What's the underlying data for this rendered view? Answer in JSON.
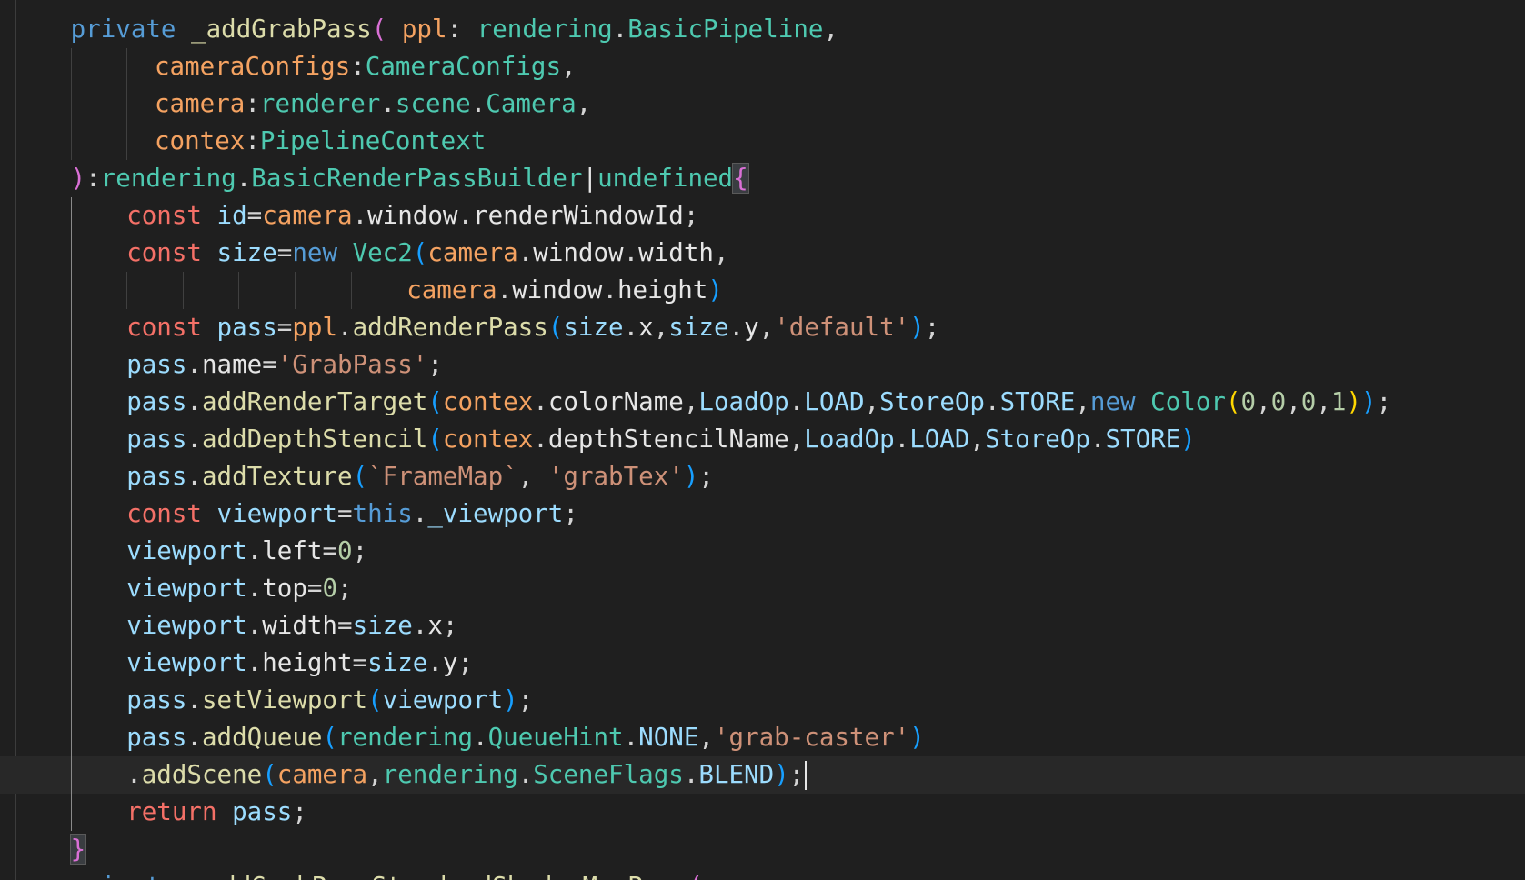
{
  "editor": {
    "language": "typescript",
    "theme_colors": {
      "background": "#1f1f1f",
      "current_line": "#282828",
      "keyword": "#569cd6",
      "control_keyword": "#f47067",
      "function": "#dcdcaa",
      "variable": "#9cdcfe",
      "parameter": "#f4a261",
      "type": "#4ec9b0",
      "string": "#ce9178",
      "number": "#b5cea8"
    },
    "lines": [
      {
        "indent": 4,
        "tokens": [
          {
            "t": "private ",
            "c": "kw"
          },
          {
            "t": "_addGrabPass",
            "c": "fn"
          },
          {
            "t": "( ",
            "c": "br-pink"
          },
          {
            "t": "ppl",
            "c": "param"
          },
          {
            "t": ": ",
            "c": "punc"
          },
          {
            "t": "rendering",
            "c": "type"
          },
          {
            "t": ".",
            "c": "punc"
          },
          {
            "t": "BasicPipeline",
            "c": "type"
          },
          {
            "t": ",",
            "c": "punc"
          }
        ]
      },
      {
        "indent": 10,
        "tokens": [
          {
            "t": "cameraConfigs",
            "c": "param"
          },
          {
            "t": ":",
            "c": "punc"
          },
          {
            "t": "CameraConfigs",
            "c": "type"
          },
          {
            "t": ",",
            "c": "punc"
          }
        ]
      },
      {
        "indent": 10,
        "tokens": [
          {
            "t": "camera",
            "c": "param"
          },
          {
            "t": ":",
            "c": "punc"
          },
          {
            "t": "renderer",
            "c": "type"
          },
          {
            "t": ".",
            "c": "punc"
          },
          {
            "t": "scene",
            "c": "type"
          },
          {
            "t": ".",
            "c": "punc"
          },
          {
            "t": "Camera",
            "c": "type"
          },
          {
            "t": ",",
            "c": "punc"
          }
        ]
      },
      {
        "indent": 10,
        "tokens": [
          {
            "t": "contex",
            "c": "param"
          },
          {
            "t": ":",
            "c": "punc"
          },
          {
            "t": "PipelineContext",
            "c": "type"
          }
        ]
      },
      {
        "indent": 4,
        "tokens": [
          {
            "t": ")",
            "c": "br-pink"
          },
          {
            "t": ":",
            "c": "punc"
          },
          {
            "t": "rendering",
            "c": "type"
          },
          {
            "t": ".",
            "c": "punc"
          },
          {
            "t": "BasicRenderPassBuilder",
            "c": "type"
          },
          {
            "t": "|",
            "c": "white"
          },
          {
            "t": "undefined",
            "c": "type"
          },
          {
            "t": "{",
            "c": "br-pink",
            "box": true
          }
        ]
      },
      {
        "indent": 8,
        "tokens": [
          {
            "t": "const ",
            "c": "ctrl"
          },
          {
            "t": "id",
            "c": "var"
          },
          {
            "t": "=",
            "c": "punc"
          },
          {
            "t": "camera",
            "c": "param"
          },
          {
            "t": ".",
            "c": "punc"
          },
          {
            "t": "window",
            "c": "ident"
          },
          {
            "t": ".",
            "c": "punc"
          },
          {
            "t": "renderWindowId",
            "c": "ident"
          },
          {
            "t": ";",
            "c": "punc"
          }
        ]
      },
      {
        "indent": 8,
        "tokens": [
          {
            "t": "const ",
            "c": "ctrl"
          },
          {
            "t": "size",
            "c": "var"
          },
          {
            "t": "=",
            "c": "punc"
          },
          {
            "t": "new ",
            "c": "kw"
          },
          {
            "t": "Vec2",
            "c": "type"
          },
          {
            "t": "(",
            "c": "br-blue"
          },
          {
            "t": "camera",
            "c": "param"
          },
          {
            "t": ".",
            "c": "punc"
          },
          {
            "t": "window",
            "c": "ident"
          },
          {
            "t": ".",
            "c": "punc"
          },
          {
            "t": "width",
            "c": "ident"
          },
          {
            "t": ",",
            "c": "punc"
          }
        ]
      },
      {
        "indent": 28,
        "tokens": [
          {
            "t": "camera",
            "c": "param"
          },
          {
            "t": ".",
            "c": "punc"
          },
          {
            "t": "window",
            "c": "ident"
          },
          {
            "t": ".",
            "c": "punc"
          },
          {
            "t": "height",
            "c": "ident"
          },
          {
            "t": ")",
            "c": "br-blue"
          }
        ]
      },
      {
        "indent": 8,
        "tokens": [
          {
            "t": "const ",
            "c": "ctrl"
          },
          {
            "t": "pass",
            "c": "var"
          },
          {
            "t": "=",
            "c": "punc"
          },
          {
            "t": "ppl",
            "c": "param"
          },
          {
            "t": ".",
            "c": "punc"
          },
          {
            "t": "addRenderPass",
            "c": "fn"
          },
          {
            "t": "(",
            "c": "br-blue"
          },
          {
            "t": "size",
            "c": "var"
          },
          {
            "t": ".",
            "c": "punc"
          },
          {
            "t": "x",
            "c": "ident"
          },
          {
            "t": ",",
            "c": "punc"
          },
          {
            "t": "size",
            "c": "var"
          },
          {
            "t": ".",
            "c": "punc"
          },
          {
            "t": "y",
            "c": "ident"
          },
          {
            "t": ",",
            "c": "punc"
          },
          {
            "t": "'default'",
            "c": "str"
          },
          {
            "t": ")",
            "c": "br-blue"
          },
          {
            "t": ";",
            "c": "punc"
          }
        ]
      },
      {
        "indent": 8,
        "tokens": [
          {
            "t": "pass",
            "c": "var"
          },
          {
            "t": ".",
            "c": "punc"
          },
          {
            "t": "name",
            "c": "ident"
          },
          {
            "t": "=",
            "c": "punc"
          },
          {
            "t": "'GrabPass'",
            "c": "str"
          },
          {
            "t": ";",
            "c": "punc"
          }
        ]
      },
      {
        "indent": 8,
        "tokens": [
          {
            "t": "pass",
            "c": "var"
          },
          {
            "t": ".",
            "c": "punc"
          },
          {
            "t": "addRenderTarget",
            "c": "fn"
          },
          {
            "t": "(",
            "c": "br-blue"
          },
          {
            "t": "contex",
            "c": "param"
          },
          {
            "t": ".",
            "c": "punc"
          },
          {
            "t": "colorName",
            "c": "ident"
          },
          {
            "t": ",",
            "c": "punc"
          },
          {
            "t": "LoadOp",
            "c": "var"
          },
          {
            "t": ".",
            "c": "punc"
          },
          {
            "t": "LOAD",
            "c": "var"
          },
          {
            "t": ",",
            "c": "punc"
          },
          {
            "t": "StoreOp",
            "c": "var"
          },
          {
            "t": ".",
            "c": "punc"
          },
          {
            "t": "STORE",
            "c": "var"
          },
          {
            "t": ",",
            "c": "punc"
          },
          {
            "t": "new ",
            "c": "kw"
          },
          {
            "t": "Color",
            "c": "type"
          },
          {
            "t": "(",
            "c": "br-gold"
          },
          {
            "t": "0",
            "c": "num"
          },
          {
            "t": ",",
            "c": "punc"
          },
          {
            "t": "0",
            "c": "num"
          },
          {
            "t": ",",
            "c": "punc"
          },
          {
            "t": "0",
            "c": "num"
          },
          {
            "t": ",",
            "c": "punc"
          },
          {
            "t": "1",
            "c": "num"
          },
          {
            "t": ")",
            "c": "br-gold"
          },
          {
            "t": ")",
            "c": "br-blue"
          },
          {
            "t": ";",
            "c": "punc"
          }
        ]
      },
      {
        "indent": 8,
        "tokens": [
          {
            "t": "pass",
            "c": "var"
          },
          {
            "t": ".",
            "c": "punc"
          },
          {
            "t": "addDepthStencil",
            "c": "fn"
          },
          {
            "t": "(",
            "c": "br-blue"
          },
          {
            "t": "contex",
            "c": "param"
          },
          {
            "t": ".",
            "c": "punc"
          },
          {
            "t": "depthStencilName",
            "c": "ident"
          },
          {
            "t": ",",
            "c": "punc"
          },
          {
            "t": "LoadOp",
            "c": "var"
          },
          {
            "t": ".",
            "c": "punc"
          },
          {
            "t": "LOAD",
            "c": "var"
          },
          {
            "t": ",",
            "c": "punc"
          },
          {
            "t": "StoreOp",
            "c": "var"
          },
          {
            "t": ".",
            "c": "punc"
          },
          {
            "t": "STORE",
            "c": "var"
          },
          {
            "t": ")",
            "c": "br-blue"
          }
        ]
      },
      {
        "indent": 8,
        "tokens": [
          {
            "t": "pass",
            "c": "var"
          },
          {
            "t": ".",
            "c": "punc"
          },
          {
            "t": "addTexture",
            "c": "fn"
          },
          {
            "t": "(",
            "c": "br-blue"
          },
          {
            "t": "`FrameMap`",
            "c": "str"
          },
          {
            "t": ", ",
            "c": "punc"
          },
          {
            "t": "'grabTex'",
            "c": "str"
          },
          {
            "t": ")",
            "c": "br-blue"
          },
          {
            "t": ";",
            "c": "punc"
          }
        ]
      },
      {
        "indent": 8,
        "tokens": [
          {
            "t": "const ",
            "c": "ctrl"
          },
          {
            "t": "viewport",
            "c": "var"
          },
          {
            "t": "=",
            "c": "punc"
          },
          {
            "t": "this",
            "c": "kw"
          },
          {
            "t": ".",
            "c": "punc"
          },
          {
            "t": "_viewport",
            "c": "var"
          },
          {
            "t": ";",
            "c": "punc"
          }
        ]
      },
      {
        "indent": 8,
        "tokens": [
          {
            "t": "viewport",
            "c": "var"
          },
          {
            "t": ".",
            "c": "punc"
          },
          {
            "t": "left",
            "c": "ident"
          },
          {
            "t": "=",
            "c": "punc"
          },
          {
            "t": "0",
            "c": "num"
          },
          {
            "t": ";",
            "c": "punc"
          }
        ]
      },
      {
        "indent": 8,
        "tokens": [
          {
            "t": "viewport",
            "c": "var"
          },
          {
            "t": ".",
            "c": "punc"
          },
          {
            "t": "top",
            "c": "ident"
          },
          {
            "t": "=",
            "c": "punc"
          },
          {
            "t": "0",
            "c": "num"
          },
          {
            "t": ";",
            "c": "punc"
          }
        ]
      },
      {
        "indent": 8,
        "tokens": [
          {
            "t": "viewport",
            "c": "var"
          },
          {
            "t": ".",
            "c": "punc"
          },
          {
            "t": "width",
            "c": "ident"
          },
          {
            "t": "=",
            "c": "punc"
          },
          {
            "t": "size",
            "c": "var"
          },
          {
            "t": ".",
            "c": "punc"
          },
          {
            "t": "x",
            "c": "ident"
          },
          {
            "t": ";",
            "c": "punc"
          }
        ]
      },
      {
        "indent": 8,
        "tokens": [
          {
            "t": "viewport",
            "c": "var"
          },
          {
            "t": ".",
            "c": "punc"
          },
          {
            "t": "height",
            "c": "ident"
          },
          {
            "t": "=",
            "c": "punc"
          },
          {
            "t": "size",
            "c": "var"
          },
          {
            "t": ".",
            "c": "punc"
          },
          {
            "t": "y",
            "c": "ident"
          },
          {
            "t": ";",
            "c": "punc"
          }
        ]
      },
      {
        "indent": 8,
        "tokens": [
          {
            "t": "pass",
            "c": "var"
          },
          {
            "t": ".",
            "c": "punc"
          },
          {
            "t": "setViewport",
            "c": "fn"
          },
          {
            "t": "(",
            "c": "br-blue"
          },
          {
            "t": "viewport",
            "c": "var"
          },
          {
            "t": ")",
            "c": "br-blue"
          },
          {
            "t": ";",
            "c": "punc"
          }
        ]
      },
      {
        "indent": 8,
        "tokens": [
          {
            "t": "pass",
            "c": "var"
          },
          {
            "t": ".",
            "c": "punc"
          },
          {
            "t": "addQueue",
            "c": "fn"
          },
          {
            "t": "(",
            "c": "br-blue"
          },
          {
            "t": "rendering",
            "c": "type"
          },
          {
            "t": ".",
            "c": "punc"
          },
          {
            "t": "QueueHint",
            "c": "type"
          },
          {
            "t": ".",
            "c": "punc"
          },
          {
            "t": "NONE",
            "c": "var"
          },
          {
            "t": ",",
            "c": "punc"
          },
          {
            "t": "'grab-caster'",
            "c": "str"
          },
          {
            "t": ")",
            "c": "br-blue"
          }
        ]
      },
      {
        "indent": 8,
        "current": true,
        "caret": true,
        "tokens": [
          {
            "t": ".",
            "c": "punc"
          },
          {
            "t": "addScene",
            "c": "fn"
          },
          {
            "t": "(",
            "c": "br-blue"
          },
          {
            "t": "camera",
            "c": "param"
          },
          {
            "t": ",",
            "c": "punc"
          },
          {
            "t": "rendering",
            "c": "type"
          },
          {
            "t": ".",
            "c": "punc"
          },
          {
            "t": "SceneFlags",
            "c": "type"
          },
          {
            "t": ".",
            "c": "punc"
          },
          {
            "t": "BLEND",
            "c": "var"
          },
          {
            "t": ")",
            "c": "br-blue"
          },
          {
            "t": ";",
            "c": "punc"
          }
        ]
      },
      {
        "indent": 8,
        "tokens": [
          {
            "t": "return ",
            "c": "ctrl"
          },
          {
            "t": "pass",
            "c": "var"
          },
          {
            "t": ";",
            "c": "punc"
          }
        ]
      },
      {
        "indent": 4,
        "tokens": [
          {
            "t": "}",
            "c": "br-pink",
            "box": true
          }
        ]
      },
      {
        "indent": 4,
        "tokens": [
          {
            "t": "private ",
            "c": "kw"
          },
          {
            "t": "_addGrabPassStandardShadowMapPass",
            "c": "fn"
          },
          {
            "t": "(",
            "c": "br-pink"
          }
        ]
      }
    ]
  }
}
